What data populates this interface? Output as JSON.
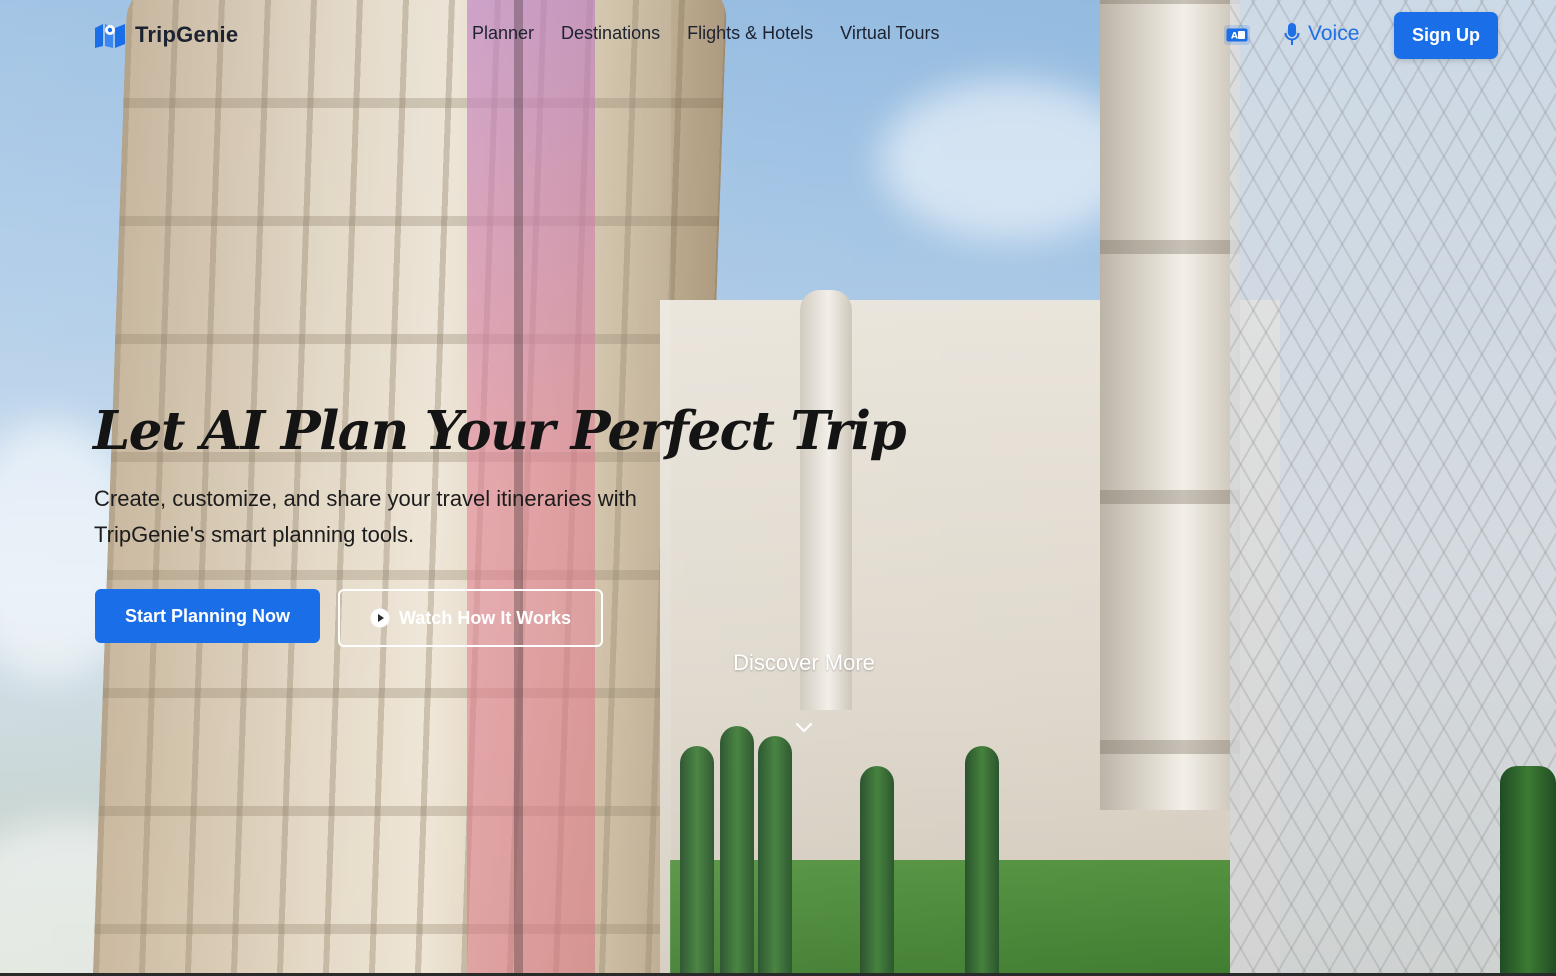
{
  "brand": {
    "name": "TripGenie",
    "accent": "#1a6ee8",
    "icon": "map-icon"
  },
  "nav": {
    "links": [
      "Planner",
      "Destinations",
      "Flights & Hotels",
      "Virtual Tours"
    ],
    "translate_icon": "translate-icon",
    "voice_label": "Voice",
    "voice_icon": "microphone-icon",
    "signup_label": "Sign Up"
  },
  "hero": {
    "title": "Let AI Plan Your Perfect Trip",
    "subtitle": "Create, customize, and share your travel itineraries with TripGenie's smart planning tools.",
    "primary_cta": "Start Planning Now",
    "secondary_cta": "Watch How It Works",
    "secondary_icon": "play-icon",
    "discover_label": "Discover More",
    "discover_icon": "chevron-down-icon"
  }
}
